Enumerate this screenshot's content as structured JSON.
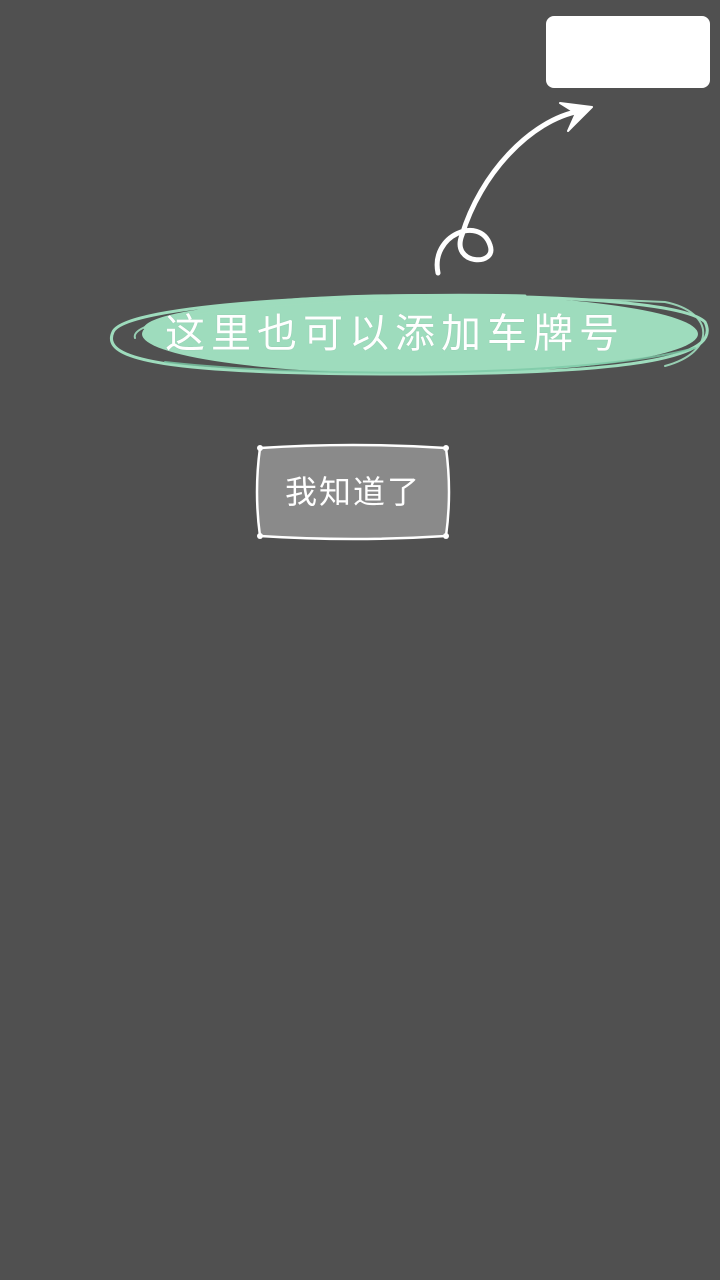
{
  "guide": {
    "tip_text": "这里也可以添加车牌号",
    "confirm_label": "我知道了"
  },
  "colors": {
    "overlay": "#505050",
    "highlight": "#ffffff",
    "bubble_fill": "#9edcbd",
    "button_fill": "#8a8a8a"
  },
  "icons": {
    "arrow": "curved-arrow-icon"
  }
}
